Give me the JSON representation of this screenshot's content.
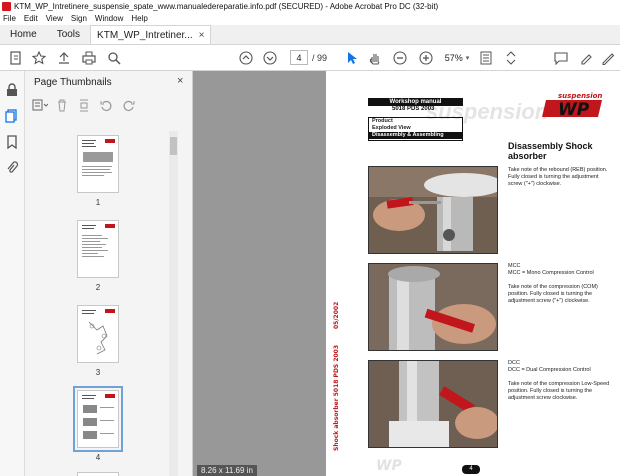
{
  "window": {
    "title": "KTM_WP_Intretinere_suspensie_spate_www.manualedereparatie.info.pdf (SECURED) - Adobe Acrobat Pro DC (32-bit)"
  },
  "menu": [
    "File",
    "Edit",
    "View",
    "Sign",
    "Window",
    "Help"
  ],
  "tabs": {
    "home": "Home",
    "tools": "Tools",
    "document": "KTM_WP_Intretiner...",
    "close": "×"
  },
  "toolbar": {
    "page_current": "4",
    "page_total": "/ 99",
    "zoom": "57%"
  },
  "panel": {
    "title": "Page Thumbnails",
    "close": "×",
    "thumbnails": [
      {
        "label": "1",
        "selected": false
      },
      {
        "label": "2",
        "selected": false
      },
      {
        "label": "3",
        "selected": false
      },
      {
        "label": "4",
        "selected": true
      }
    ]
  },
  "document": {
    "size_label": "8.26 x 11.69 in",
    "header": "Workshop manual",
    "model": "5018 PDS 2003",
    "menu_box": [
      "Product",
      "Exploded View",
      "Disassembly & Assembling"
    ],
    "logo_small": "suspension",
    "logo_big": "WP",
    "watermark": "suspension",
    "section_title": "Disassembly Shock absorber",
    "step1": "Take note of the rebound (REB) position. Fully closed is turning the adjustment screw (\"+\") clockwise.",
    "mcc_heading": "MCC",
    "mcc_def": "MCC = Mono Compression Control",
    "step2": "Take note of the compression (COM) position. Fully closed is turning the adjustment screw (\"+\") clockwise.",
    "dcc_heading": "DCC",
    "dcc_def": "DCC = Dual Compression Control",
    "step3": "Take note of the compression Low-Speed position. Fully closed is turning the adjustment screw clockwise.",
    "side_text": "Shock absorber 5018 PDS 2003",
    "side_date": "05/2002",
    "footer_logo": "WP",
    "page_number": "4"
  },
  "colors": {
    "accent": "#1473e6",
    "brand_red": "#c0161c",
    "doc_bg": "#989898"
  }
}
